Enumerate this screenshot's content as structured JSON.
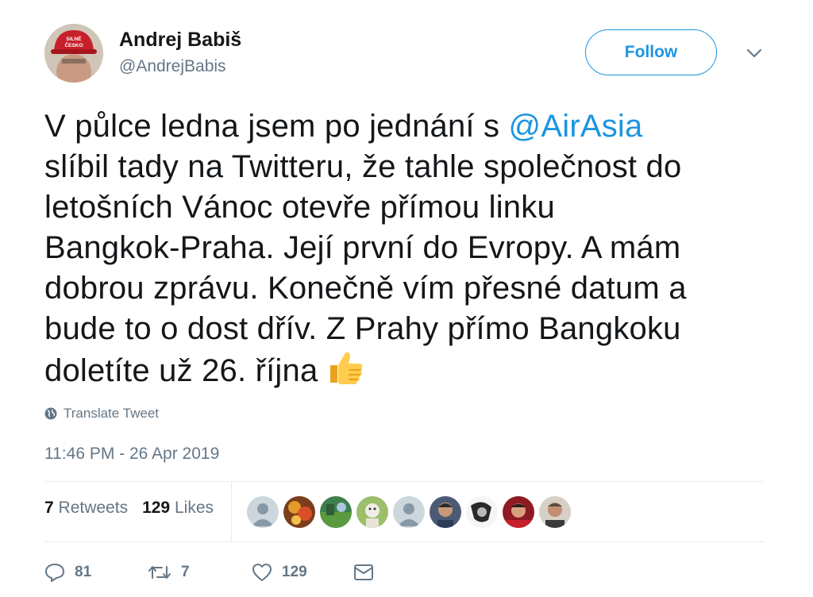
{
  "author": {
    "name": "Andrej Babiš",
    "handle": "@AndrejBabis",
    "avatar_cap_text": "SILNÉ ČESKO"
  },
  "follow_label": "Follow",
  "tweet": {
    "lines": [
      "V půlce ledna jsem po jednání s ",
      "slíbil tady na Twitteru, že tahle společnost do",
      "letošních Vánoc otevře přímou linku",
      "Bangkok-Praha. Její první do Evropy. A mám",
      "dobrou zprávu. Konečně vím přesné datum a",
      "bude to o dost dřív. Z Prahy přímo Bangkoku",
      "doletíte už 26. října"
    ],
    "mention": "@AirAsia",
    "emoji": "thumbs-up-icon"
  },
  "translate_label": "Translate Tweet",
  "timestamp": "11:46 PM - 26 Apr 2019",
  "stats": {
    "retweets_count": "7",
    "retweets_label": "Retweets",
    "likes_count": "129",
    "likes_label": "Likes"
  },
  "actions": {
    "replies": "81",
    "retweets": "7",
    "likes": "129"
  },
  "colors": {
    "link": "#1b95e0",
    "secondary": "#657786",
    "text": "#14171a",
    "border": "#e6ecf0"
  }
}
